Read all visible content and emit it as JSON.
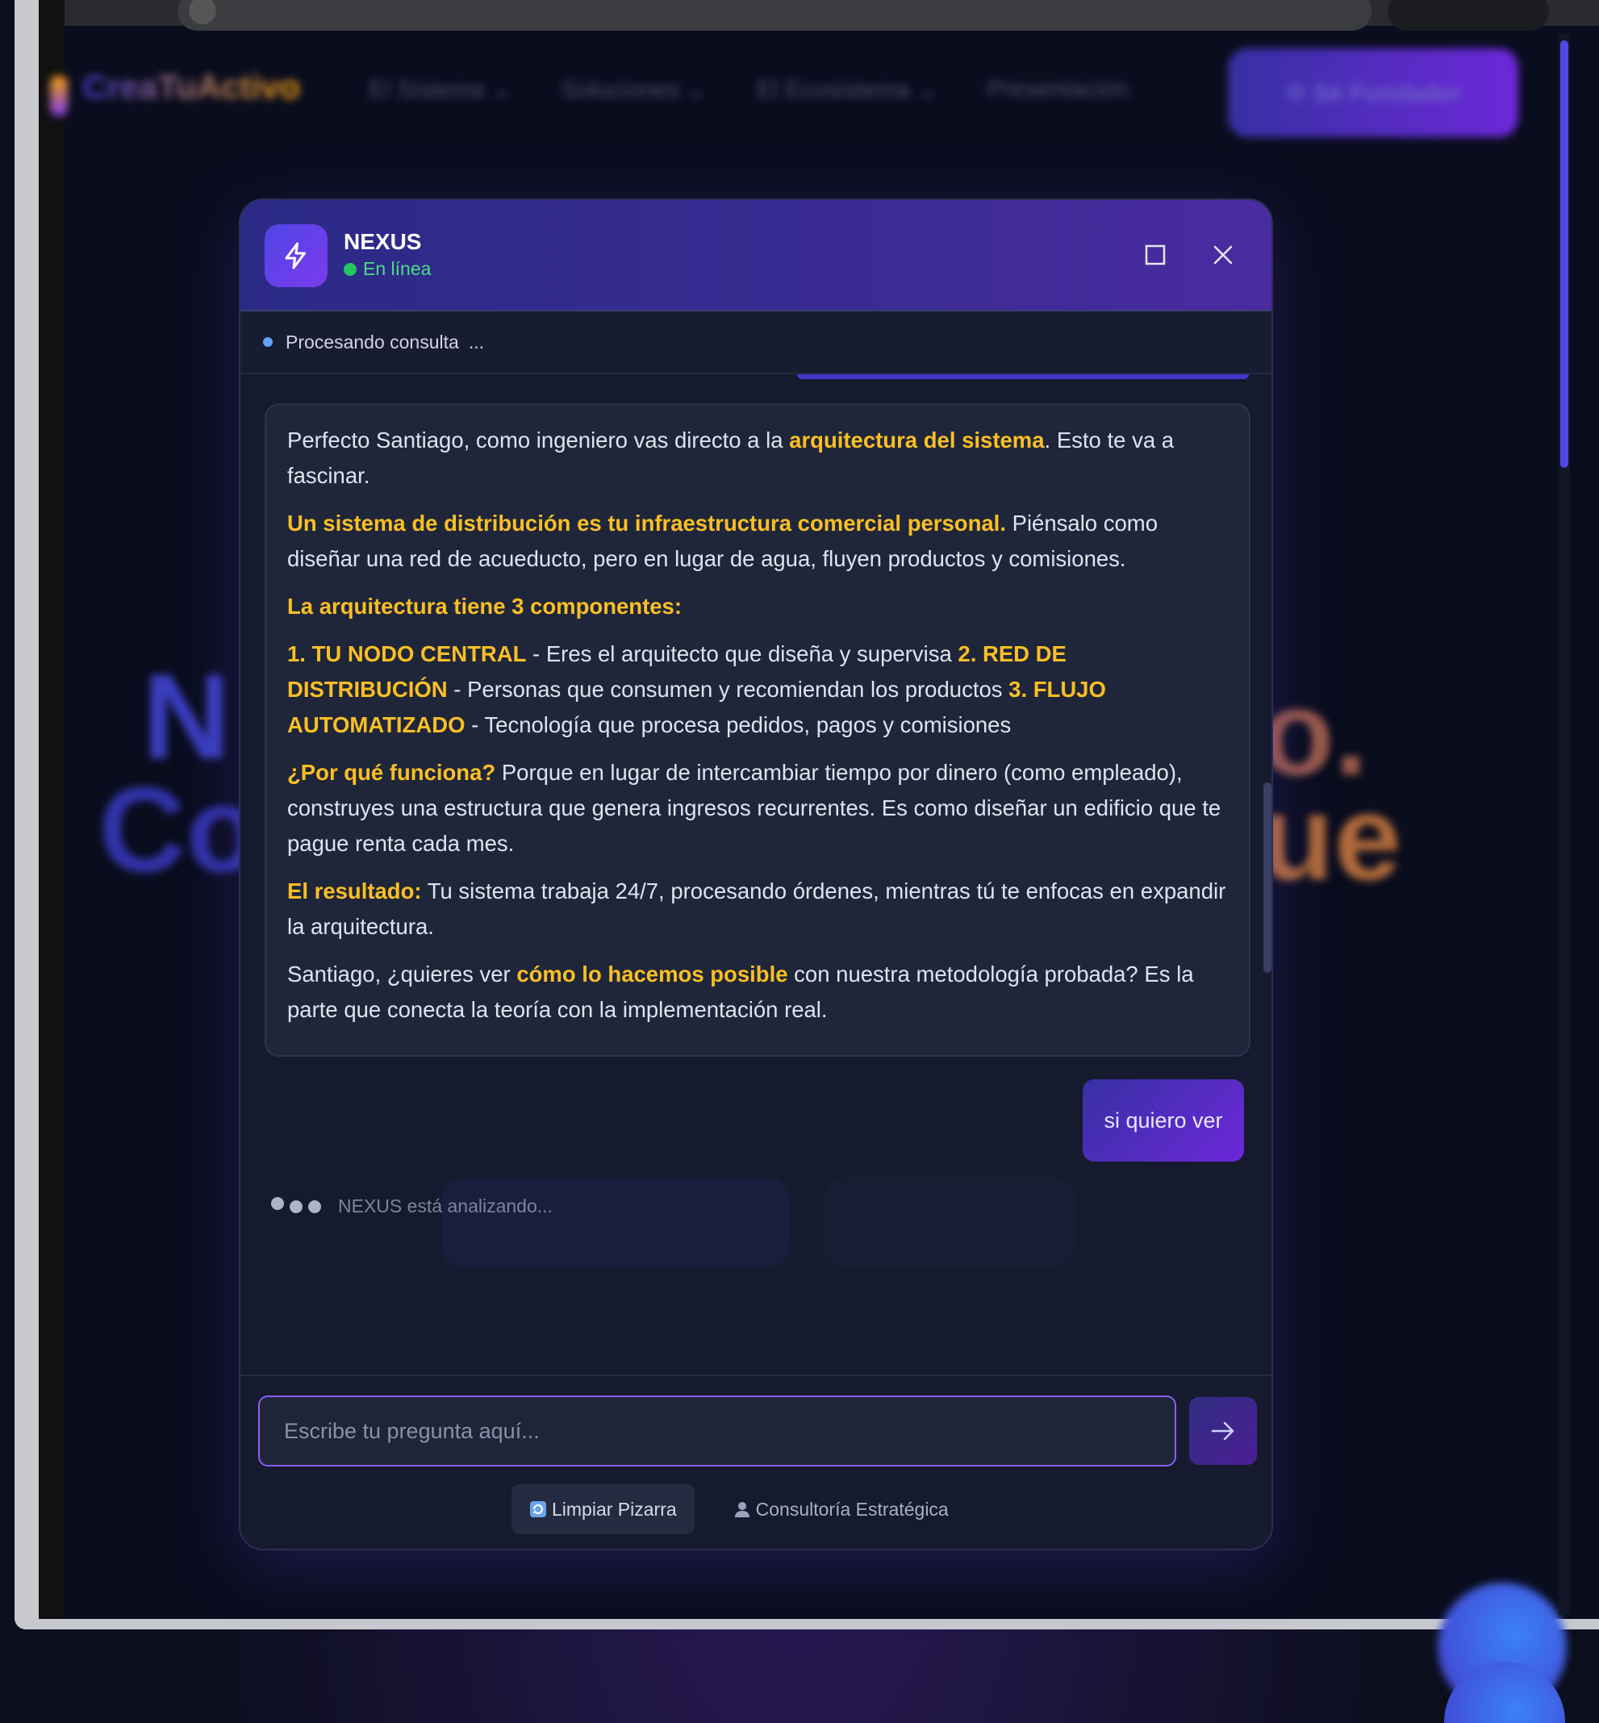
{
  "site": {
    "logo": "CreaTuActivo",
    "nav": [
      "El Sistema ⌄",
      "Soluciones ⌄",
      "El Ecosistema ⌄",
      "Presentación"
    ],
    "cta": "⚙ Sé Fundador",
    "hero_left_1": "N",
    "hero_left_2": "Co",
    "hero_right_1": "o.",
    "hero_right_2": "ue"
  },
  "chat": {
    "bot_name": "NEXUS",
    "status": "En línea",
    "processing": "Procesando consulta",
    "processing_suffix": "...",
    "bot_message": {
      "p1_a": "Perfecto Santiago, como ingeniero vas directo a la ",
      "p1_hl": "arquitectura del sistema",
      "p1_b": ". Esto te va a fascinar.",
      "p2_hl": "Un sistema de distribución es tu infraestructura comercial personal.",
      "p2_b": " Piénsalo como diseñar una red de acueducto, pero en lugar de agua, fluyen productos y comisiones.",
      "p3_hl": "La arquitectura tiene 3 componentes:",
      "p4_hl1": "1. TU NODO CENTRAL",
      "p4_a": " - Eres el arquitecto que diseña y supervisa ",
      "p4_hl2": "2. RED DE DISTRIBUCIÓN",
      "p4_b": " - Personas que consumen y recomiendan los productos ",
      "p4_hl3": "3. FLUJO AUTOMATIZADO",
      "p4_c": " - Tecnología que procesa pedidos, pagos y comisiones",
      "p5_hl": "¿Por qué funciona?",
      "p5_b": " Porque en lugar de intercambiar tiempo por dinero (como empleado), construyes una estructura que genera ingresos recurrentes. Es como diseñar un edificio que te pague renta cada mes.",
      "p6_hl": "El resultado:",
      "p6_b": " Tu sistema trabaja 24/7, procesando órdenes, mientras tú te enfocas en expandir la arquitectura.",
      "p7_a": "Santiago, ¿quieres ver ",
      "p7_hl": "cómo lo hacemos posible",
      "p7_b": " con nuestra metodología probada? Es la parte que conecta la teoría con la implementación real."
    },
    "user_message": "si quiero ver",
    "typing_text": "NEXUS está analizando...",
    "input_placeholder": "Escribe tu pregunta aquí...",
    "input_value": "",
    "clear_button": "Limpiar Pizarra",
    "consult_button": "Consultoría Estratégica"
  },
  "colors": {
    "highlight": "#fbbf24",
    "online": "#22c55e",
    "accent": "#6d28d9",
    "processing_dot": "#60a5fa"
  },
  "icons": {
    "bot_avatar": "bolt-icon",
    "maximize": "square-icon",
    "close": "close-icon",
    "send": "arrow-right-icon",
    "clear": "refresh-icon",
    "consult": "person-icon"
  }
}
